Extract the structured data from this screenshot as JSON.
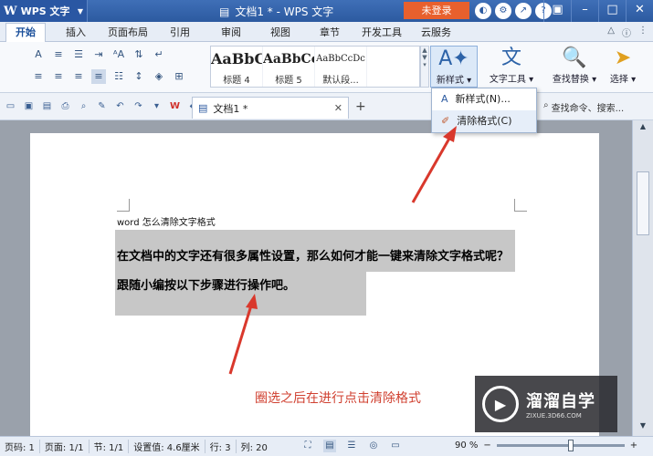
{
  "titlebar": {
    "logo": "W",
    "app_name": "WPS 文字",
    "doc_title": "文档1 * - WPS 文字",
    "login": "未登录"
  },
  "menu": {
    "tabs": [
      "开始",
      "插入",
      "页面布局",
      "引用",
      "审阅",
      "视图",
      "章节",
      "开发工具",
      "云服务"
    ]
  },
  "ribbon": {
    "styles": [
      {
        "sample": "AaBbC",
        "label": "标题 4"
      },
      {
        "sample": "AaBbCc",
        "label": "标题 5"
      },
      {
        "sample": "AaBbCcDc",
        "label": "默认段..."
      }
    ],
    "new_style": "新样式",
    "text_tools": "文字工具",
    "find_replace": "查找替换",
    "select": "选择"
  },
  "quickbar": {
    "doc_tab": "文档1 *",
    "search_placeholder": "查找命令、搜索..."
  },
  "dropdown": {
    "items": [
      "新样式(N)...",
      "清除格式(C)"
    ]
  },
  "document": {
    "heading": "word 怎么清除文字格式",
    "body": "在文档中的文字还有很多属性设置，那么如何才能一键来清除文字格式呢？跟随小编按以下步骤进行操作吧。",
    "annotation": "圈选之后在进行点击清除格式"
  },
  "watermark": {
    "title": "溜溜自学",
    "sub": "ZIXUE.3D66.COM"
  },
  "statusbar": {
    "page_num": "页码: 1",
    "page": "页面: 1/1",
    "section": "节: 1/1",
    "setting": "设置值: 4.6厘米",
    "row": "行: 3",
    "col": "列: 20",
    "zoom": "90 %",
    "zoom_fraction": 0.58
  },
  "colors": {
    "accent": "#2c5aa0",
    "login": "#e8602d",
    "annotation": "#d04030",
    "selection": "#c7c7c7"
  }
}
